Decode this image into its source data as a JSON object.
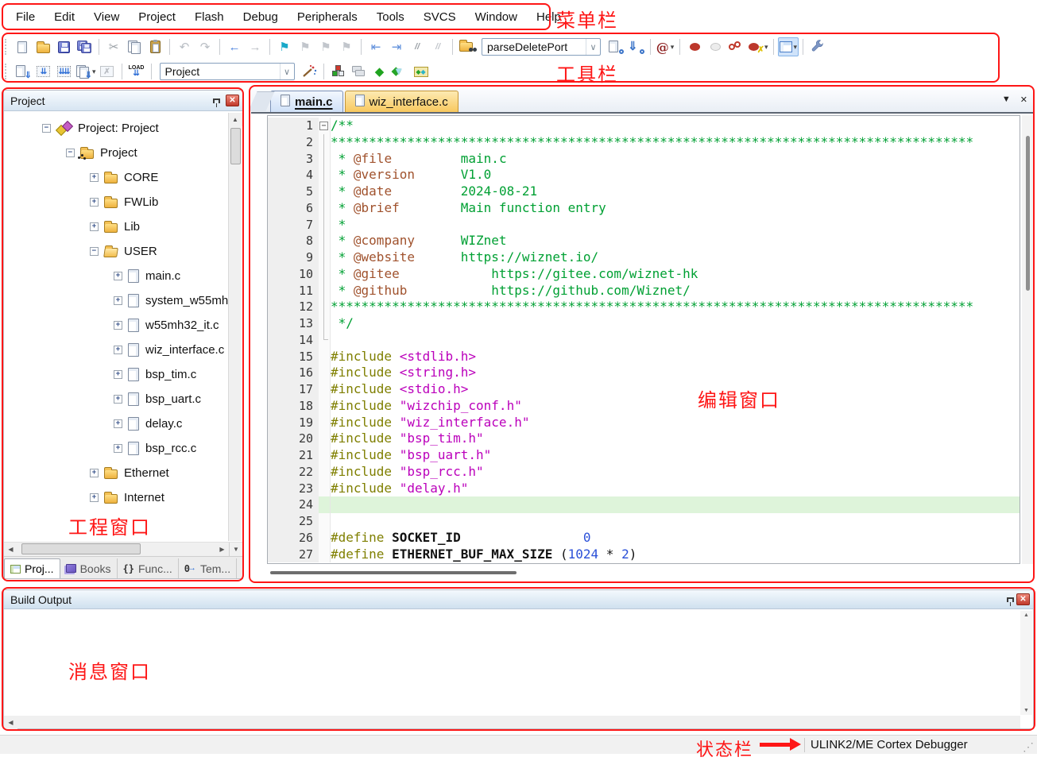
{
  "colors": {
    "red": "#fe1616",
    "cm": "#00a033",
    "dx": "#a0522d",
    "pp": "#7f7f00",
    "st": "#bb00bb",
    "nu": "#2b50d8",
    "hl": "#def4da",
    "tabActive": "#cfe0f7",
    "tabInactive": "#f8c85e"
  },
  "annotations": {
    "menu": "菜单栏",
    "toolbar": "工具栏",
    "editor": "编辑窗口",
    "project": "工程窗口",
    "output": "消息窗口",
    "status": "状态栏"
  },
  "menu": {
    "items": [
      "File",
      "Edit",
      "View",
      "Project",
      "Flash",
      "Debug",
      "Peripherals",
      "Tools",
      "SVCS",
      "Window",
      "Help"
    ]
  },
  "toolbar": {
    "row1": [
      {
        "n": "new-file-button",
        "k": "page"
      },
      {
        "n": "open-file-button",
        "k": "folder"
      },
      {
        "n": "save-button",
        "k": "floppy"
      },
      {
        "n": "save-all-button",
        "k": "floppy2"
      },
      {
        "k": "sep"
      },
      {
        "n": "cut-button",
        "k": "glyph",
        "g": "✂",
        "c": "#9aa0a6"
      },
      {
        "n": "copy-button",
        "k": "copy"
      },
      {
        "n": "paste-button",
        "k": "clipboard"
      },
      {
        "k": "sep"
      },
      {
        "n": "undo-button",
        "k": "glyph",
        "g": "↶",
        "c": "#b9bec4"
      },
      {
        "n": "redo-button",
        "k": "glyph",
        "g": "↷",
        "c": "#b9bec4"
      },
      {
        "k": "sep"
      },
      {
        "n": "navigate-back-button",
        "k": "glyph",
        "g": "←",
        "c": "#4d82dd"
      },
      {
        "n": "navigate-forward-button",
        "k": "glyph",
        "g": "→",
        "c": "#b9bec4"
      },
      {
        "k": "sep"
      },
      {
        "n": "insert-bookmark-button",
        "k": "glyph",
        "g": "⚑",
        "c": "#19a9c9"
      },
      {
        "n": "previous-bookmark-button",
        "k": "glyph",
        "g": "⚑",
        "c": "#c2c6cc"
      },
      {
        "n": "next-bookmark-button",
        "k": "glyph",
        "g": "⚑",
        "c": "#c2c6cc"
      },
      {
        "n": "clear-bookmarks-button",
        "k": "glyph",
        "g": "⚑",
        "c": "#c2c6cc"
      },
      {
        "k": "sep"
      },
      {
        "n": "unindent-button",
        "k": "glyph",
        "g": "⇤",
        "c": "#5b8ddb"
      },
      {
        "n": "indent-button",
        "k": "glyph",
        "g": "⇥",
        "c": "#5b8ddb"
      },
      {
        "n": "comment-button",
        "k": "text",
        "g": "//",
        "c": "#9aa0a6"
      },
      {
        "n": "uncomment-button",
        "k": "text",
        "g": "//",
        "c": "#c2c6cc"
      },
      {
        "k": "sep"
      },
      {
        "n": "find-in-files-button",
        "k": "binocfolder"
      },
      {
        "n": "find-combo",
        "k": "combo",
        "value": "parseDeletePort",
        "w": 150
      },
      {
        "n": "search-files-button",
        "k": "searchpage"
      },
      {
        "n": "incremental-find-button",
        "k": "incfind"
      },
      {
        "k": "sep"
      },
      {
        "n": "lookup-button",
        "k": "at",
        "caret": true
      },
      {
        "k": "sep"
      },
      {
        "n": "insert-breakpoint-button",
        "k": "dot"
      },
      {
        "n": "enable-breakpoint-button",
        "k": "dotring"
      },
      {
        "n": "disable-all-breakpoints-button",
        "k": "dots2"
      },
      {
        "n": "kill-all-breakpoints-button",
        "k": "dotx",
        "caret": true
      },
      {
        "k": "sep"
      },
      {
        "n": "window-layout-button",
        "k": "layout",
        "caret": true,
        "selected": true
      },
      {
        "k": "sep"
      },
      {
        "n": "configure-button",
        "k": "wrench"
      }
    ],
    "row2": [
      {
        "n": "translate-button",
        "k": "translate"
      },
      {
        "n": "build-button",
        "k": "buildbox"
      },
      {
        "n": "rebuild-all-button",
        "k": "rebuildbox"
      },
      {
        "n": "batch-build-button",
        "k": "batchbox",
        "caret": true
      },
      {
        "n": "stop-build-button",
        "k": "stopbox"
      },
      {
        "k": "sep"
      },
      {
        "n": "download-button",
        "k": "load",
        "label": "LOAD"
      },
      {
        "k": "sep"
      },
      {
        "n": "target-combo",
        "k": "combo",
        "value": "Project",
        "w": 170
      },
      {
        "n": "target-options-button",
        "k": "wand"
      },
      {
        "k": "sep"
      },
      {
        "n": "manage-rte-button",
        "k": "blocks"
      },
      {
        "n": "manage-project-items-button",
        "k": "winstack"
      },
      {
        "n": "pack-installer-button",
        "k": "glyph",
        "g": "◆",
        "c": "#1fa31f"
      },
      {
        "n": "select-software-packs-button",
        "k": "funnel"
      },
      {
        "n": "software-packs-button",
        "k": "packbox"
      }
    ]
  },
  "project_panel": {
    "title": "Project",
    "tree": [
      {
        "label": "Project: Project",
        "lvl": 0,
        "exp": "-",
        "icon": "targets"
      },
      {
        "label": "Project",
        "lvl": 1,
        "exp": "-",
        "icon": "target"
      },
      {
        "label": "CORE",
        "lvl": 2,
        "exp": "+",
        "icon": "folder"
      },
      {
        "label": "FWLib",
        "lvl": 2,
        "exp": "+",
        "icon": "folder"
      },
      {
        "label": "Lib",
        "lvl": 2,
        "exp": "+",
        "icon": "folder"
      },
      {
        "label": "USER",
        "lvl": 2,
        "exp": "-",
        "icon": "folder-open"
      },
      {
        "label": "main.c",
        "lvl": 3,
        "exp": "+",
        "icon": "file"
      },
      {
        "label": "system_w55mh",
        "lvl": 3,
        "exp": "+",
        "icon": "file"
      },
      {
        "label": "w55mh32_it.c",
        "lvl": 3,
        "exp": "+",
        "icon": "file"
      },
      {
        "label": "wiz_interface.c",
        "lvl": 3,
        "exp": "+",
        "icon": "file"
      },
      {
        "label": "bsp_tim.c",
        "lvl": 3,
        "exp": "+",
        "icon": "file"
      },
      {
        "label": "bsp_uart.c",
        "lvl": 3,
        "exp": "+",
        "icon": "file"
      },
      {
        "label": "delay.c",
        "lvl": 3,
        "exp": "+",
        "icon": "file"
      },
      {
        "label": "bsp_rcc.c",
        "lvl": 3,
        "exp": "+",
        "icon": "file"
      },
      {
        "label": "Ethernet",
        "lvl": 2,
        "exp": "+",
        "icon": "folder"
      },
      {
        "label": "Internet",
        "lvl": 2,
        "exp": "+",
        "icon": "folder"
      }
    ],
    "tabs": [
      {
        "label": "Proj...",
        "icon": "project",
        "active": true
      },
      {
        "label": "Books",
        "icon": "books",
        "active": false
      },
      {
        "label": "Func...",
        "icon": "functions",
        "active": false
      },
      {
        "label": "Tem...",
        "icon": "templates",
        "active": false
      }
    ]
  },
  "editor": {
    "tabs": [
      {
        "label": "main.c",
        "active": true
      },
      {
        "label": "wiz_interface.c",
        "active": false
      }
    ],
    "code": [
      {
        "n": 1,
        "fold": "start",
        "segs": [
          [
            "cm",
            "/**"
          ]
        ]
      },
      {
        "n": 2,
        "fold": "mid",
        "segs": [
          [
            "cm",
            "************************************************************************************"
          ]
        ]
      },
      {
        "n": 3,
        "fold": "mid",
        "segs": [
          [
            "cm",
            " * "
          ],
          [
            "dx",
            "@file"
          ],
          [
            "cm",
            "         main.c"
          ]
        ]
      },
      {
        "n": 4,
        "fold": "mid",
        "segs": [
          [
            "cm",
            " * "
          ],
          [
            "dx",
            "@version"
          ],
          [
            "cm",
            "      V1.0"
          ]
        ]
      },
      {
        "n": 5,
        "fold": "mid",
        "segs": [
          [
            "cm",
            " * "
          ],
          [
            "dx",
            "@date"
          ],
          [
            "cm",
            "         2024-08-21"
          ]
        ]
      },
      {
        "n": 6,
        "fold": "mid",
        "segs": [
          [
            "cm",
            " * "
          ],
          [
            "dx",
            "@brief"
          ],
          [
            "cm",
            "        Main function entry"
          ]
        ]
      },
      {
        "n": 7,
        "fold": "mid",
        "segs": [
          [
            "cm",
            " *"
          ]
        ]
      },
      {
        "n": 8,
        "fold": "mid",
        "segs": [
          [
            "cm",
            " * "
          ],
          [
            "dx",
            "@company"
          ],
          [
            "cm",
            "      WIZnet"
          ]
        ]
      },
      {
        "n": 9,
        "fold": "mid",
        "segs": [
          [
            "cm",
            " * "
          ],
          [
            "dx",
            "@website"
          ],
          [
            "cm",
            "      https://wiznet.io/"
          ]
        ]
      },
      {
        "n": 10,
        "fold": "mid",
        "segs": [
          [
            "cm",
            " * "
          ],
          [
            "dx",
            "@gitee"
          ],
          [
            "cm",
            "            https://gitee.com/wiznet-hk"
          ]
        ]
      },
      {
        "n": 11,
        "fold": "mid",
        "segs": [
          [
            "cm",
            " * "
          ],
          [
            "dx",
            "@github"
          ],
          [
            "cm",
            "           https://github.com/Wiznet/"
          ]
        ]
      },
      {
        "n": 12,
        "fold": "mid",
        "segs": [
          [
            "cm",
            "************************************************************************************"
          ]
        ]
      },
      {
        "n": 13,
        "fold": "mid",
        "segs": [
          [
            "cm",
            " */"
          ]
        ]
      },
      {
        "n": 14,
        "fold": "end",
        "segs": []
      },
      {
        "n": 15,
        "segs": [
          [
            "pp",
            "#include "
          ],
          [
            "st",
            "<stdlib.h>"
          ]
        ]
      },
      {
        "n": 16,
        "segs": [
          [
            "pp",
            "#include "
          ],
          [
            "st",
            "<string.h>"
          ]
        ]
      },
      {
        "n": 17,
        "segs": [
          [
            "pp",
            "#include "
          ],
          [
            "st",
            "<stdio.h>"
          ]
        ]
      },
      {
        "n": 18,
        "segs": [
          [
            "pp",
            "#include "
          ],
          [
            "st",
            "\"wizchip_conf.h\""
          ]
        ]
      },
      {
        "n": 19,
        "segs": [
          [
            "pp",
            "#include "
          ],
          [
            "st",
            "\"wiz_interface.h\""
          ]
        ]
      },
      {
        "n": 20,
        "segs": [
          [
            "pp",
            "#include "
          ],
          [
            "st",
            "\"bsp_tim.h\""
          ]
        ]
      },
      {
        "n": 21,
        "segs": [
          [
            "pp",
            "#include "
          ],
          [
            "st",
            "\"bsp_uart.h\""
          ]
        ]
      },
      {
        "n": 22,
        "segs": [
          [
            "pp",
            "#include "
          ],
          [
            "st",
            "\"bsp_rcc.h\""
          ]
        ]
      },
      {
        "n": 23,
        "segs": [
          [
            "pp",
            "#include "
          ],
          [
            "st",
            "\"delay.h\""
          ]
        ]
      },
      {
        "n": 24,
        "hl": true,
        "segs": []
      },
      {
        "n": 25,
        "segs": []
      },
      {
        "n": 26,
        "segs": [
          [
            "pp",
            "#define "
          ],
          [
            "id",
            "SOCKET_ID"
          ],
          [
            "pl",
            "                "
          ],
          [
            "nu",
            "0"
          ]
        ]
      },
      {
        "n": 27,
        "segs": [
          [
            "pp",
            "#define "
          ],
          [
            "id",
            "ETHERNET_BUF_MAX_SIZE"
          ],
          [
            "pl",
            " ("
          ],
          [
            "nu",
            "1024"
          ],
          [
            "pl",
            " * "
          ],
          [
            "nu",
            "2"
          ],
          [
            "pl",
            ")"
          ]
        ]
      }
    ]
  },
  "output_panel": {
    "title": "Build Output"
  },
  "status_bar": {
    "debugger": "ULINK2/ME Cortex Debugger"
  }
}
